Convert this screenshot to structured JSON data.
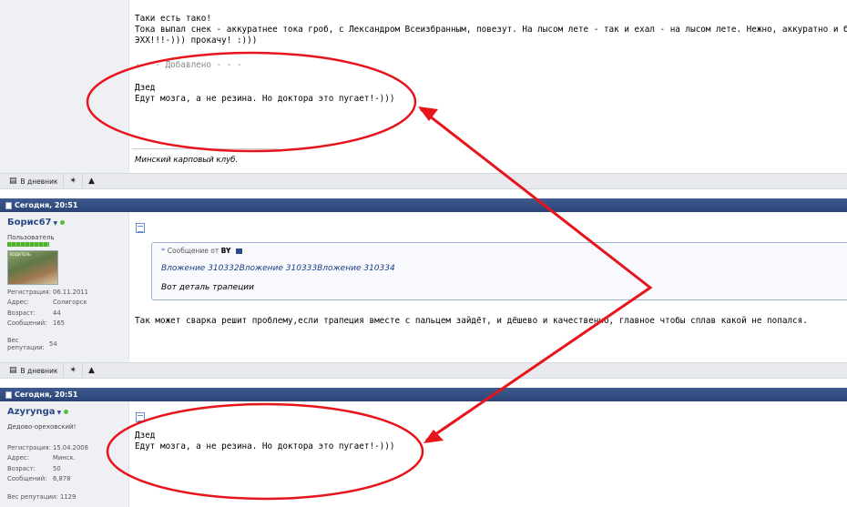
{
  "post1": {
    "lines": [
      "Таки есть тако!",
      "Тока выпал снек - аккуратнее тока гроб, с Лександром Всеизбранным, повезут. На лысом лете - так и ехал - на лысом лете. Нежно, аккуратно и б",
      "ЭХХ!!!-))) прокачу! :)))"
    ],
    "added_divider": "- - - Добавлено - - -",
    "quote_author": "Дзед",
    "quote_text": "Едут мозга, а не резина. Но доктора это пугает!-)))",
    "signature": "Минский карповый клуб."
  },
  "toolbar": {
    "diary_label": "В дневник"
  },
  "post2": {
    "header_date": "Сегодня, 20:51",
    "username": "Борис67",
    "user_title": "Пользователь",
    "avatar_caption": "ВОДИТЕЛЬ",
    "stats": [
      {
        "key": "Регистрация:",
        "value": "06.11.2011"
      },
      {
        "key": "Адрес:",
        "value": "Солигорск"
      },
      {
        "key": "Возраст:",
        "value": "44"
      },
      {
        "key": "Сообщений:",
        "value": "165"
      }
    ],
    "rep_label": "Вес репутации:",
    "rep_value": "54",
    "quote_label": "Сообщение от",
    "quote_from": "BY",
    "quote_attachments": "Вложение 310332Вложение 310333Вложение 310334",
    "quote_text": "Вот деталь трапеции",
    "body": "Так может сварка решит проблему,если трапеция вместе с пальцем зайдёт, и дёшево и качественно, главное чтобы сплав какой не попался."
  },
  "post3": {
    "header_date": "Сегодня, 20:51",
    "username": "Azyrynga",
    "user_title": "Дедово-ореховский!",
    "stats": [
      {
        "key": "Регистрация:",
        "value": "15.04.2008"
      },
      {
        "key": "Адрес:",
        "value": "Минск."
      },
      {
        "key": "Возраст:",
        "value": "50"
      },
      {
        "key": "Сообщений:",
        "value": "6,878"
      }
    ],
    "rep_label": "Вес репутации:",
    "rep_value": "1129",
    "quote_author": "Дзед",
    "quote_text": "Едут мозга, а не резина. Но доктора это пугает!-)))"
  },
  "colors": {
    "header_bar": "#2b4478",
    "annotation": "#e8141c",
    "online": "#5bbf3a",
    "username": "#2a4a86"
  }
}
